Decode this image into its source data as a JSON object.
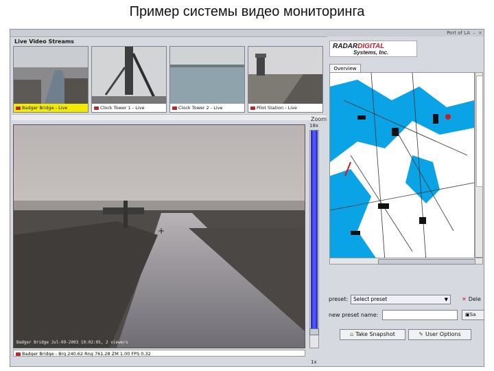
{
  "slide_title": "Пример системы видео мониторинга",
  "window": {
    "title": "Port of LA"
  },
  "streams": {
    "label": "Live Video Streams",
    "items": [
      {
        "name": "Badger Bridge - Live",
        "active": true
      },
      {
        "name": "Clock Tower 1 - Live",
        "active": false
      },
      {
        "name": "Clock Tower 2 - Live",
        "active": false
      },
      {
        "name": "Pilot Station - Live",
        "active": false
      }
    ]
  },
  "main_view": {
    "overlay": "Badger Bridge Jul-09-2003 10:02:05, 2 viewers",
    "status": "Badger Bridge - Brg 240.62 Rng 761.28 ZM 1.00 FPS 0.32",
    "crosshair": "+"
  },
  "zoom": {
    "label": "Zoom",
    "max": "18x",
    "min": "1x",
    "level": 0.06
  },
  "right": {
    "logo_main": "RADAR",
    "logo_accent": "DIGITAL",
    "logo_sub": "Systems, Inc.",
    "tab_overview": "Overview",
    "preset_label": "preset:",
    "preset_value": "Select preset",
    "delete_label": "Dele",
    "new_preset_label": "new preset name:",
    "save_label": "Sa",
    "snapshot_label": "Take Snapshot",
    "user_options_label": "User Options"
  },
  "colors": {
    "highlight": "#f2ea00",
    "water": "#0aa3e6",
    "zoom_fill": "#1a1fd0",
    "cam_icon": "#c0242b"
  },
  "icons": [
    "camera-icon",
    "delete-x-icon",
    "save-disk-icon",
    "snapshot-icon",
    "user-icon",
    "chevron-down-icon"
  ]
}
